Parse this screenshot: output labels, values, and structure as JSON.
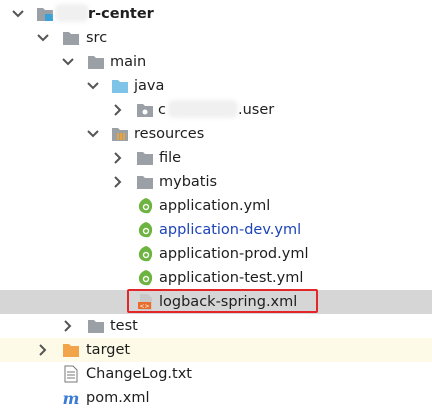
{
  "tree": {
    "root": {
      "label": "r-center"
    },
    "src": {
      "label": "src"
    },
    "main": {
      "label": "main"
    },
    "java": {
      "label": "java"
    },
    "package": {
      "label_prefix": "c",
      "label_suffix": ".user"
    },
    "resources": {
      "label": "resources"
    },
    "file": {
      "label": "file"
    },
    "mybatis": {
      "label": "mybatis"
    },
    "application_yml": {
      "label": "application.yml"
    },
    "application_dev_yml": {
      "label": "application-dev.yml"
    },
    "application_prod_yml": {
      "label": "application-prod.yml"
    },
    "application_test_yml": {
      "label": "application-test.yml"
    },
    "logback_xml": {
      "label": "logback-spring.xml"
    },
    "test": {
      "label": "test"
    },
    "target": {
      "label": "target"
    },
    "changelog": {
      "label": "ChangeLog.txt"
    },
    "pom": {
      "label": "pom.xml"
    }
  },
  "colors": {
    "selected_row": "#d6d6d6",
    "highlight_border": "#e3262a",
    "spring_green": "#6db33f",
    "folder_gray": "#9aa0a6",
    "folder_blue": "#7ec4e8",
    "folder_orange": "#f2a44b",
    "maven_blue": "#3b7bd6"
  }
}
